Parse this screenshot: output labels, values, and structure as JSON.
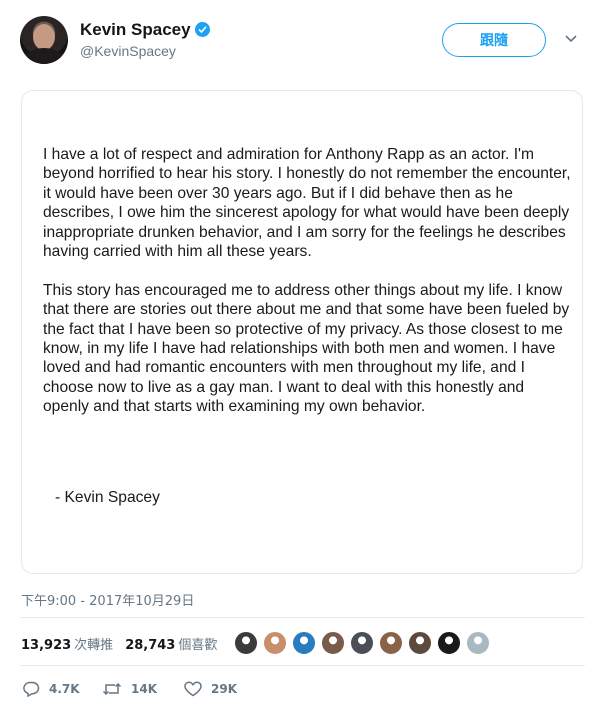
{
  "author": {
    "display_name": "Kevin Spacey",
    "handle": "@KevinSpacey",
    "verified_icon": "verified-badge-icon"
  },
  "header": {
    "follow_label": "跟隨",
    "menu_icon": "chevron-down-icon"
  },
  "statement": {
    "paragraphs": [
      "I have a lot of respect and admiration for Anthony Rapp as an actor. I'm beyond horrified to hear his story. I honestly do not remember the encounter, it would have been over 30 years ago. But if I did behave then as he describes, I owe him the sincerest apology for what would have been deeply inappropriate drunken behavior, and I am sorry for the feelings he describes having carried with him all these years.",
      "This story has encouraged me to address other things about my life. I know that there are stories out there about me and that some have been fueled by the fact that I have been so protective of my privacy. As those closest to me know, in my life I have had relationships with both men and women. I have loved and had romantic encounters with men throughout my life, and I choose now to live as a gay man.  I want to deal with this honestly and openly and that starts with examining my own behavior."
    ],
    "signature": "- Kevin Spacey"
  },
  "timestamp": "下午9:00 - 2017年10月29日",
  "stats": {
    "retweets_count": "13,923",
    "retweets_label": "次轉推",
    "likes_count": "28,743",
    "likes_label": "個喜歡"
  },
  "likers": [
    {
      "color": "#3b3b3b"
    },
    {
      "color": "#c98f6a"
    },
    {
      "color": "#2a7bbf"
    },
    {
      "color": "#7a5a4a"
    },
    {
      "color": "#4a4f55"
    },
    {
      "color": "#8a6248"
    },
    {
      "color": "#5d4a3e"
    },
    {
      "color": "#1a1a1a"
    },
    {
      "color": "#aab8c2"
    }
  ],
  "actions": {
    "reply_count": "4.7K",
    "retweet_count": "14K",
    "like_count": "29K"
  },
  "colors": {
    "accent": "#1da1f2",
    "secondary_text": "#657786",
    "border": "#e1e8ed"
  }
}
